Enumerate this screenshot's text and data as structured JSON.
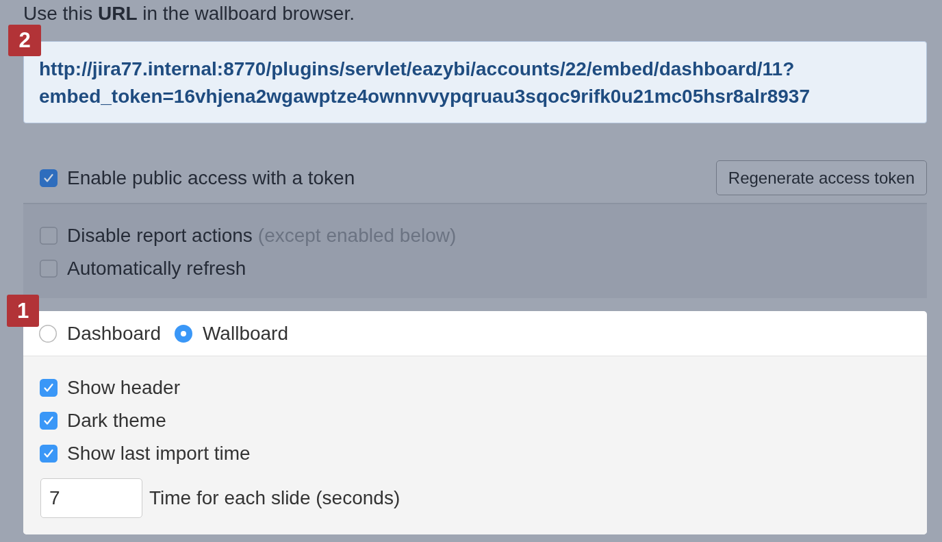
{
  "intro": "Use this **URL** in the wallboard browser.",
  "url_box": {
    "badge": "2",
    "url": "http://jira77.internal:8770/plugins/servlet/eazybi/accounts/22/embed/dashboard/11?embed_token=16vhjena2wgawptze4ownnvvypqruau3sqoc9rifk0u21mc05hsr8alr8937"
  },
  "public_access": {
    "label": "Enable public access with a token",
    "checked": true
  },
  "regenerate_button": "Regenerate access token",
  "options": [
    {
      "label": "Disable report actions",
      "note": "(except enabled below)",
      "checked": false
    },
    {
      "label": "Automatically refresh",
      "checked": false
    }
  ],
  "display_panel": {
    "badge": "1",
    "mode": [
      {
        "label": "Dashboard",
        "selected": false
      },
      {
        "label": "Wallboard",
        "selected": true
      }
    ],
    "wallboard_options": [
      {
        "label": "Show header",
        "checked": true
      },
      {
        "label": "Dark theme",
        "checked": true
      },
      {
        "label": "Show last import time",
        "checked": true
      }
    ],
    "slide_time": {
      "value": "7",
      "label": "Time for each slide (seconds)"
    }
  }
}
